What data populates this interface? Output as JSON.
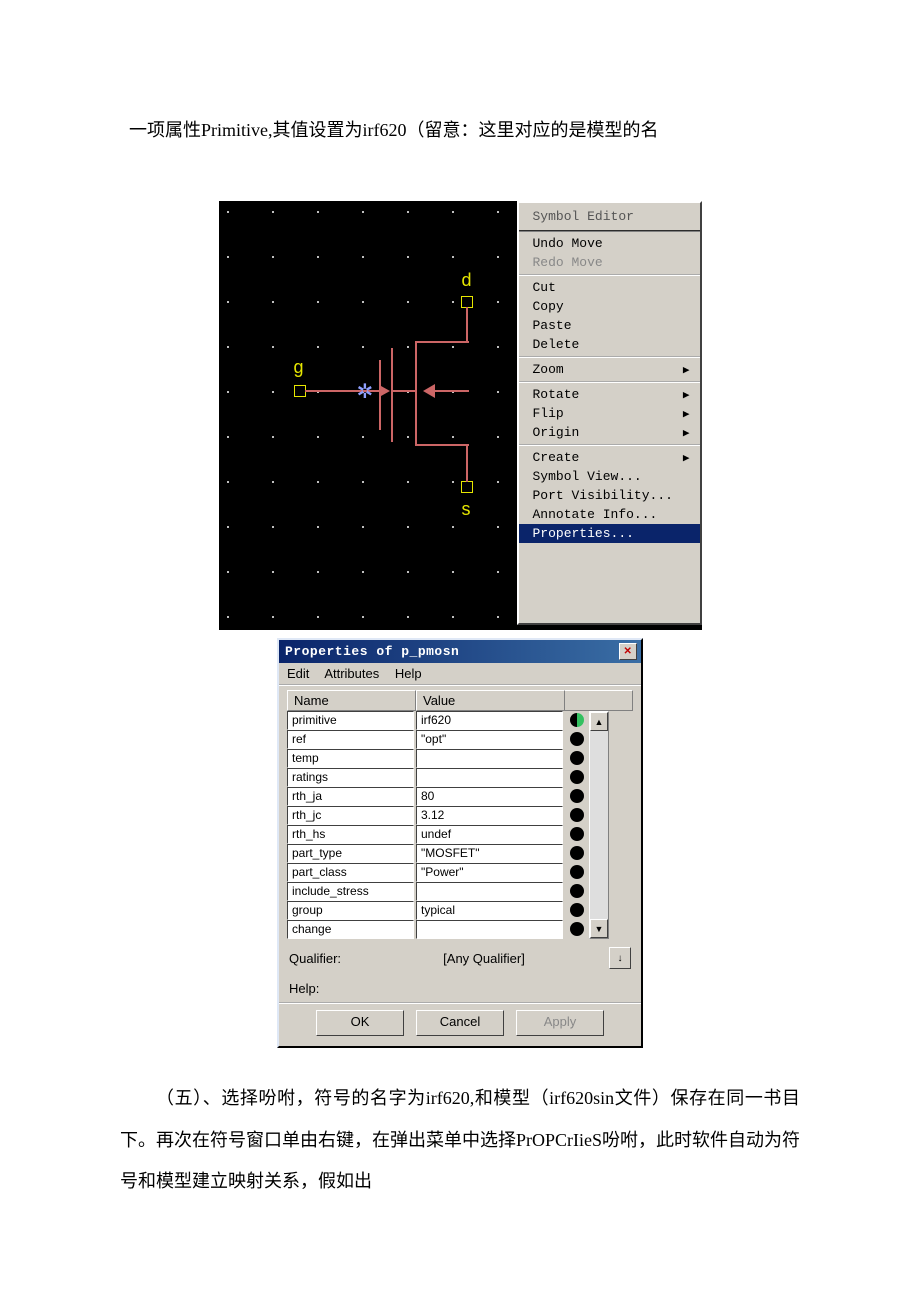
{
  "top_para": "一项属性Primitive,其值设置为irf620（留意：这里对应的是模型的名",
  "schematic": {
    "pins": {
      "d": "d",
      "g": "g",
      "s": "s"
    }
  },
  "context_menu": {
    "title": "Symbol Editor",
    "groups": [
      [
        {
          "label": "Undo Move",
          "disabled": false,
          "arrow": false
        },
        {
          "label": "Redo Move",
          "disabled": true,
          "arrow": false
        }
      ],
      [
        {
          "label": "Cut",
          "disabled": false,
          "arrow": false
        },
        {
          "label": "Copy",
          "disabled": false,
          "arrow": false
        },
        {
          "label": "Paste",
          "disabled": false,
          "arrow": false
        },
        {
          "label": "Delete",
          "disabled": false,
          "arrow": false
        }
      ],
      [
        {
          "label": "Zoom",
          "disabled": false,
          "arrow": true
        }
      ],
      [
        {
          "label": "Rotate",
          "disabled": false,
          "arrow": true
        },
        {
          "label": "Flip",
          "disabled": false,
          "arrow": true
        },
        {
          "label": "Origin",
          "disabled": false,
          "arrow": true
        }
      ],
      [
        {
          "label": "Create",
          "disabled": false,
          "arrow": true
        },
        {
          "label": "Symbol View...",
          "disabled": false,
          "arrow": false
        },
        {
          "label": "Port Visibility...",
          "disabled": false,
          "arrow": false
        },
        {
          "label": "Annotate Info...",
          "disabled": false,
          "arrow": false
        },
        {
          "label": "Properties...",
          "disabled": false,
          "arrow": false,
          "highlight": true
        }
      ]
    ]
  },
  "dialog": {
    "title": "Properties of p_pmosn",
    "menubar": [
      "Edit",
      "Attributes",
      "Help"
    ],
    "columns": {
      "name": "Name",
      "value": "Value"
    },
    "rows": [
      {
        "name": "primitive",
        "value": "irf620",
        "half": true
      },
      {
        "name": "ref",
        "value": "\"opt\"",
        "half": false
      },
      {
        "name": "temp",
        "value": "",
        "half": false
      },
      {
        "name": "ratings",
        "value": "",
        "half": false
      },
      {
        "name": "rth_ja",
        "value": "80",
        "half": false
      },
      {
        "name": "rth_jc",
        "value": "3.12",
        "half": false
      },
      {
        "name": "rth_hs",
        "value": "undef",
        "half": false
      },
      {
        "name": "part_type",
        "value": "\"MOSFET\"",
        "half": false
      },
      {
        "name": "part_class",
        "value": "\"Power\"",
        "half": false
      },
      {
        "name": "include_stress",
        "value": "",
        "half": false
      },
      {
        "name": "group",
        "value": "typical",
        "half": false
      },
      {
        "name": "change",
        "value": "",
        "half": false
      }
    ],
    "qualifier": {
      "label": "Qualifier:",
      "value": "[Any Qualifier]"
    },
    "help_label": "Help:",
    "buttons": {
      "ok": "OK",
      "cancel": "Cancel",
      "apply": "Apply"
    }
  },
  "bottom_para1": "（五）、选择吩咐，符号的名字为irf620,和模型（irf620sin文件）保存在同一书目下。再次在符号窗口单由右键，在弹出菜单中选择PrOPCrIieS吩咐，此时软件自动为符号和模型建立映射关系，假如出"
}
